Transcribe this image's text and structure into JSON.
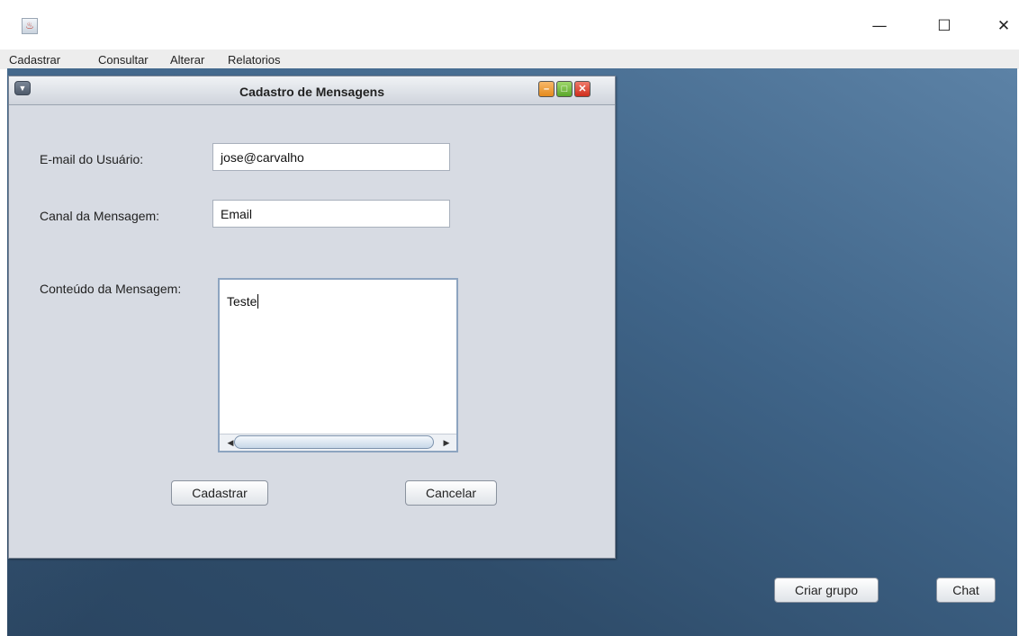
{
  "window": {
    "app_icon": "java-cup-icon",
    "minimize": "—",
    "maximize": "☐",
    "close": "✕"
  },
  "menubar": {
    "items": [
      "Cadastrar",
      "Consultar",
      "Alterar",
      "Relatorios"
    ]
  },
  "dialog": {
    "title": "Cadastro de Mensagens",
    "email_label": "E-mail do Usuário:",
    "email_value": "jose@carvalho",
    "canal_label": "Canal da Mensagem:",
    "canal_value": "Email",
    "conteudo_label": "Conteúdo da Mensagem:",
    "conteudo_value": "Teste",
    "cadastrar_button": "Cadastrar",
    "cancelar_button": "Cancelar"
  },
  "desktop": {
    "criar_grupo_button": "Criar grupo",
    "chat_button": "Chat"
  },
  "colors": {
    "desktop_dark": "#2f4d6b",
    "desktop_light": "#5c82a6",
    "frame_bg": "#d7dbe3"
  }
}
